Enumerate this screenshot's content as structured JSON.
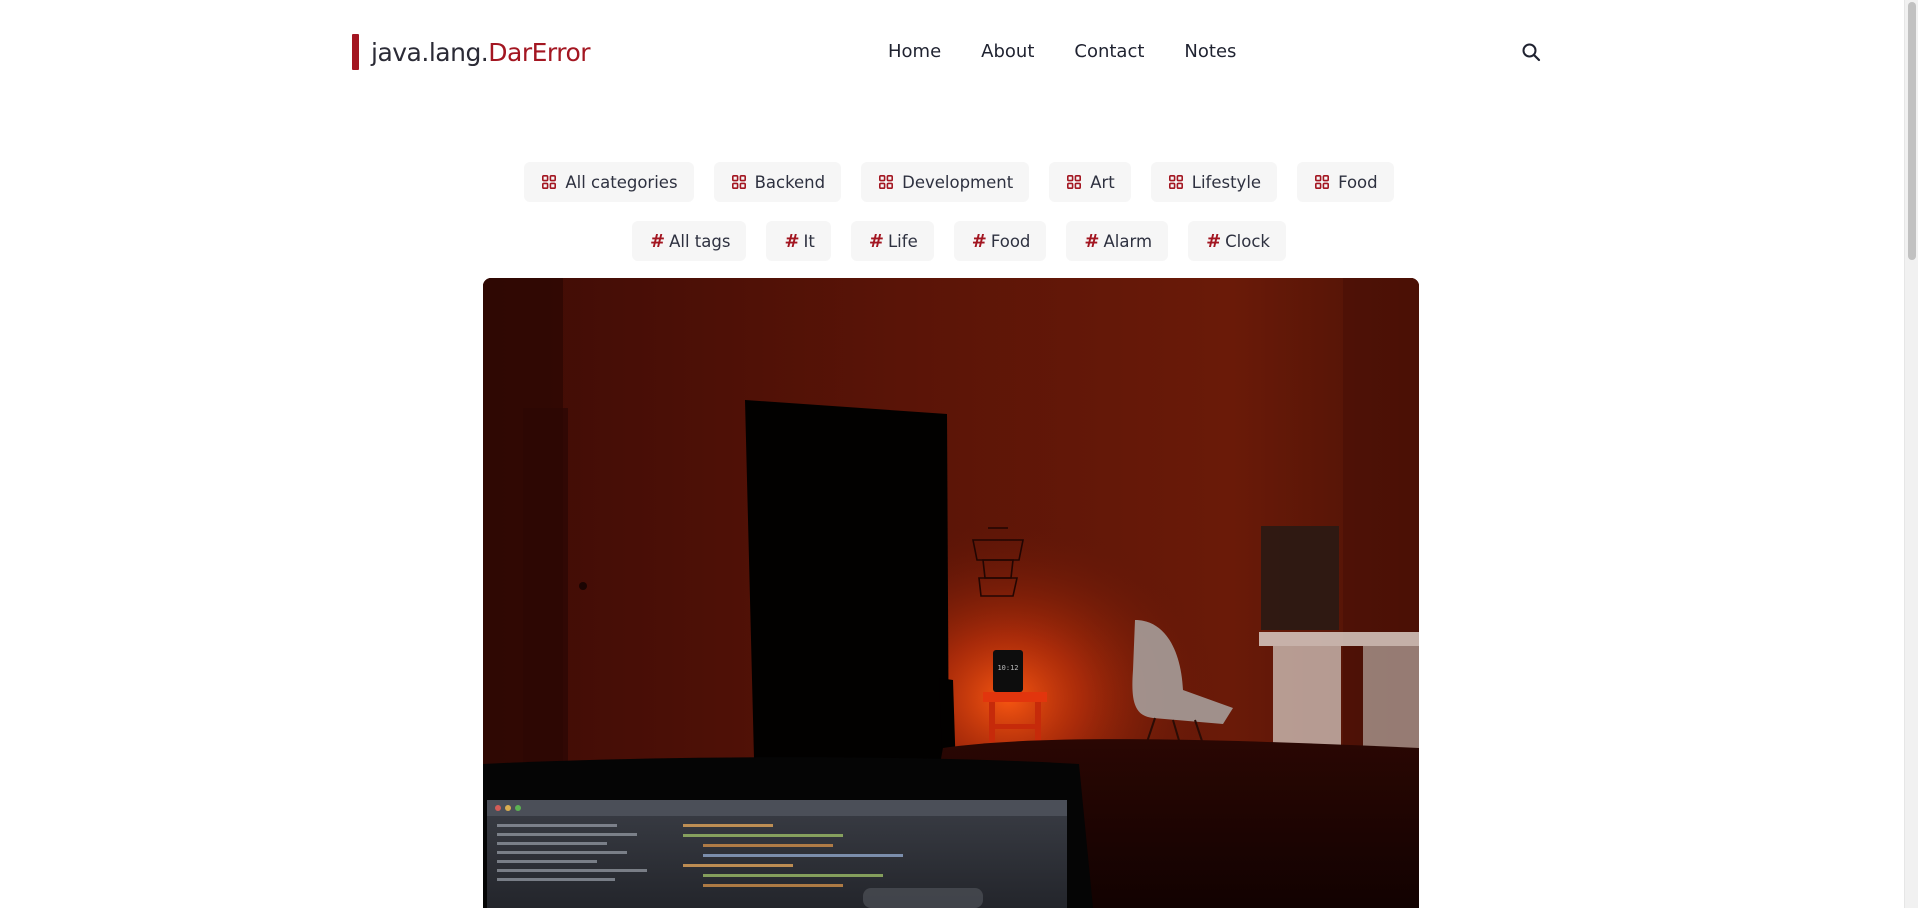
{
  "header": {
    "brand_prefix": "java.lang.",
    "brand_accent": "DarError",
    "nav": [
      {
        "label": "Home"
      },
      {
        "label": "About"
      },
      {
        "label": "Contact"
      },
      {
        "label": "Notes"
      }
    ],
    "search_icon": "search-icon"
  },
  "categories": [
    {
      "label": "All categories"
    },
    {
      "label": "Backend"
    },
    {
      "label": "Development"
    },
    {
      "label": "Art"
    },
    {
      "label": "Lifestyle"
    },
    {
      "label": "Food"
    }
  ],
  "tags": [
    {
      "label": "All tags"
    },
    {
      "label": "It"
    },
    {
      "label": "Life"
    },
    {
      "label": "Food"
    },
    {
      "label": "Alarm"
    },
    {
      "label": "Clock"
    }
  ],
  "hero": {
    "clock_text": "10:12",
    "icon": "photo-dark-room-laptop"
  },
  "colors": {
    "accent": "#a31621",
    "text": "#2b2b36",
    "pill_bg": "#f6f6f6"
  }
}
